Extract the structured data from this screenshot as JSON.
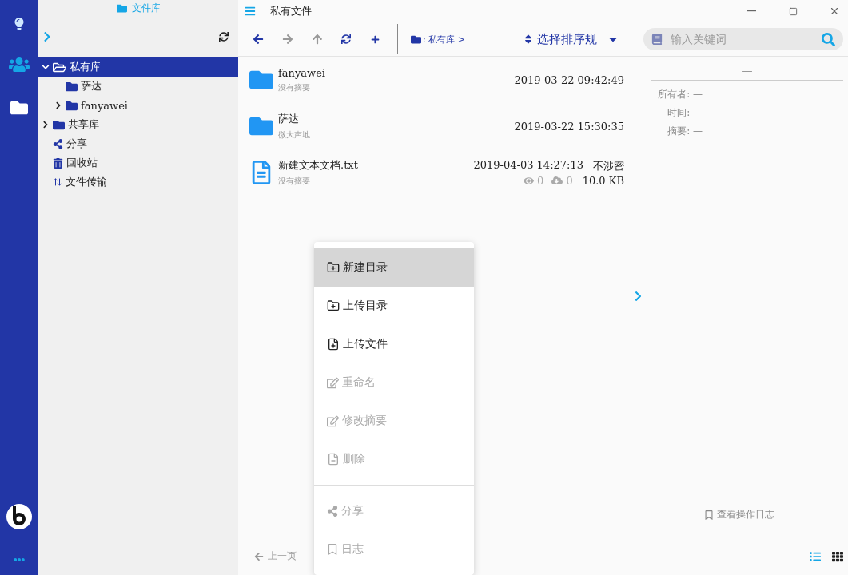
{
  "sidebar": {
    "title": "文件库",
    "tree": [
      {
        "label": "私有库",
        "kind": "folder",
        "expanded": true,
        "selected": true,
        "children": [
          {
            "label": "萨达",
            "kind": "folder",
            "selected": false
          },
          {
            "label": "fanyawei",
            "kind": "folder",
            "expanded": false,
            "selected": false
          }
        ]
      },
      {
        "label": "共享库",
        "kind": "folder",
        "expanded": false,
        "selected": false
      },
      {
        "label": "分享",
        "kind": "share",
        "selected": false
      },
      {
        "label": "回收站",
        "kind": "trash",
        "selected": false
      },
      {
        "label": "文件传输",
        "kind": "transfer",
        "selected": false
      }
    ]
  },
  "window": {
    "title": "私有文件"
  },
  "toolbar": {
    "breadcrumb": ": 私有库 >",
    "sort": "选择排序规",
    "search": {
      "placeholder": "输入关键词"
    }
  },
  "files": [
    {
      "kind": "folder",
      "name": "fanyawei",
      "summary": "没有摘要",
      "time": "2019-03-22 09:42:49"
    },
    {
      "kind": "folder",
      "name": "萨达",
      "summary": "微大声地",
      "time": "2019-03-22 15:30:35"
    },
    {
      "kind": "file",
      "name": "新建文本文档.txt",
      "summary": "没有摘要",
      "time": "2019-04-03 14:27:13",
      "secrecy": "不涉密",
      "views": "0",
      "downloads": "0",
      "size": "10.0 KB"
    }
  ],
  "detail": {
    "title": "—",
    "fields": [
      "所有者: —",
      "时间: —",
      "摘要: —"
    ],
    "log_link": "查看操作日志"
  },
  "pager": {
    "prev": "上一页"
  },
  "views": [
    {
      "kind": "list",
      "selected": true
    },
    {
      "kind": "grid",
      "selected": false
    }
  ],
  "context_menu": [
    [
      {
        "kind": "new-folder",
        "label": "新建目录",
        "selected": true,
        "disabled": false
      },
      {
        "kind": "upload-folder",
        "label": "上传目录",
        "selected": false,
        "disabled": false
      },
      {
        "kind": "upload-file",
        "label": "上传文件",
        "selected": false,
        "disabled": false
      },
      {
        "kind": "rename",
        "label": "重命名",
        "selected": false,
        "disabled": true
      },
      {
        "kind": "edit",
        "label": "修改摘要",
        "selected": false,
        "disabled": true
      },
      {
        "kind": "delete",
        "label": "删除",
        "selected": false,
        "disabled": true
      }
    ],
    [
      {
        "kind": "share",
        "label": "分享",
        "selected": false,
        "disabled": true
      },
      {
        "kind": "log",
        "label": "日志",
        "selected": false,
        "disabled": true
      }
    ]
  ]
}
